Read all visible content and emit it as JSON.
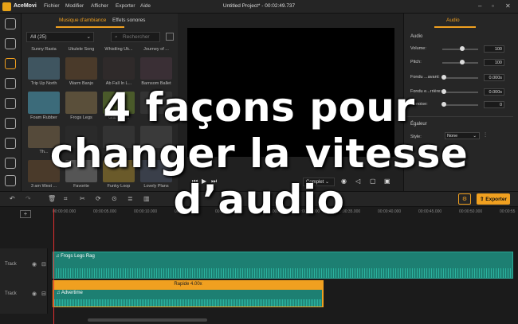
{
  "titlebar": {
    "app_name": "AceMovi",
    "menus": [
      "Fichier",
      "Modifier",
      "Afficher",
      "Exporter",
      "Aide"
    ],
    "window_title": "Untitled Project* - 00:02:49.737"
  },
  "media": {
    "tabs": [
      "Musique d'ambiance",
      "Effets sonores"
    ],
    "filter": "All (25)",
    "search_placeholder": "Rechercher",
    "items": [
      "Sunny Rasta",
      "Ukulele Song",
      "Whistling Uk...",
      "Journey of ...",
      "Trip Up North",
      "Warm Banjo",
      "Ab Fall In L...",
      "Barnsom Ballet",
      "Foam Rubber",
      "Frogs Legs",
      "Giant Bu...",
      "",
      "Th...",
      "",
      "",
      "",
      "3 am West ...",
      "Favorite",
      "Funky Loop",
      "Lovely Plans"
    ]
  },
  "preview": {
    "quality": "Complet"
  },
  "audio_panel": {
    "tab": "Audio",
    "section": "Audio",
    "volume_label": "Volume:",
    "volume_value": "100",
    "pitch_label": "Pitch:",
    "pitch_value": "100",
    "fade_in_label": "Fondu ...avant:",
    "fade_in_value": "0.000s",
    "fade_out_label": "Fondu e...rrière:",
    "fade_out_value": "0.000s",
    "denoise_label": "Denoise:",
    "denoise_value": "0",
    "eq_label": "Égaleur",
    "style_label": "Style:",
    "style_value": "None"
  },
  "toolbar": {
    "export_label": "Exporter"
  },
  "timeline": {
    "ruler": [
      "00:00:00.000",
      "00:00:05.000",
      "00:00:10.000",
      "00:00:15.000",
      "00:00:20.000",
      "00:00:25.000",
      "00:00:30.000",
      "00:00:35.000",
      "00:00:40.000",
      "00:00:45.000",
      "00:00:50.000",
      "00:00:55"
    ],
    "track1_label": "Track",
    "track2_label": "Track",
    "clip1_name": "Frogs Legs Rag",
    "clip2_name": "Advertime",
    "clip2_speed": "Rapide 4.00x"
  },
  "overlay": {
    "line1": "4 façons pour",
    "line2": "changer la vitesse",
    "line3": "d’audio"
  },
  "colors": {
    "accent": "#f0a020",
    "clip": "#1d7f72",
    "playhead": "#e03030"
  }
}
